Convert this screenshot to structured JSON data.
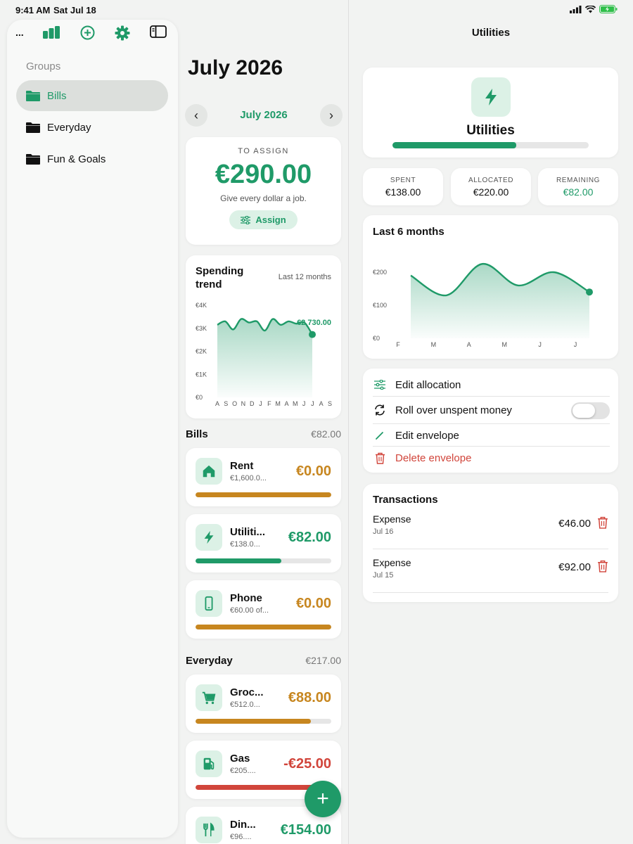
{
  "status_bar": {
    "time": "9:41 AM",
    "date": "Sat Jul 18"
  },
  "sidebar": {
    "more_label": "...",
    "groups_label": "Groups",
    "items": [
      {
        "label": "Bills",
        "active": true
      },
      {
        "label": "Everyday",
        "active": false
      },
      {
        "label": "Fun & Goals",
        "active": false
      }
    ]
  },
  "budget": {
    "month_title": "July 2026",
    "nav_month": "July 2026",
    "to_assign_label": "TO ASSIGN",
    "to_assign_amount": "€290.00",
    "to_assign_sub": "Give every dollar a job.",
    "assign_button": "Assign",
    "trend": {
      "title": "Spending trend",
      "range": "Last 12 months",
      "last_value_label": "€2,730.00"
    }
  },
  "groups": [
    {
      "name": "Bills",
      "amount": "€82.00",
      "envelopes": [
        {
          "name": "Rent",
          "sub": "€1,600.0...",
          "amount": "€0.00",
          "icon": "house-icon",
          "progress": 1.0,
          "status": "full"
        },
        {
          "name": "Utiliti...",
          "sub": "€138.0...",
          "amount": "€82.00",
          "icon": "bolt-icon",
          "progress": 0.63,
          "status": "ok"
        },
        {
          "name": "Phone",
          "sub": "€60.00 of...",
          "amount": "€0.00",
          "icon": "phone-icon",
          "progress": 1.0,
          "status": "full"
        }
      ]
    },
    {
      "name": "Everyday",
      "amount": "€217.00",
      "envelopes": [
        {
          "name": "Groc...",
          "sub": "€512.0...",
          "amount": "€88.00",
          "icon": "cart-icon",
          "progress": 0.85,
          "status": "warn"
        },
        {
          "name": "Gas",
          "sub": "€205....",
          "amount": "-€25.00",
          "icon": "fuel-icon",
          "progress": 1.0,
          "status": "over"
        },
        {
          "name": "Din...",
          "sub": "€96....",
          "amount": "€154.00",
          "icon": "fork-knife-icon",
          "progress": 0.4,
          "status": "ok"
        }
      ]
    }
  ],
  "colors": {
    "accent": "#1f9a68",
    "warn": "#c7861f",
    "over": "#d1453b",
    "track": "#e6e6e6"
  },
  "detail": {
    "nav_title": "Utilities",
    "name": "Utilities",
    "progress": 0.63,
    "stats": [
      {
        "label": "SPENT",
        "value": "€138.00"
      },
      {
        "label": "ALLOCATED",
        "value": "€220.00"
      },
      {
        "label": "REMAINING",
        "value": "€82.00"
      }
    ],
    "chart_title": "Last 6 months",
    "actions": {
      "edit_allocation": "Edit allocation",
      "rollover": "Roll over unspent money",
      "rollover_enabled": false,
      "edit_envelope": "Edit envelope",
      "delete_envelope": "Delete envelope"
    },
    "transactions_title": "Transactions",
    "transactions": [
      {
        "type": "Expense",
        "date": "Jul 16",
        "amount": "€46.00"
      },
      {
        "type": "Expense",
        "date": "Jul 15",
        "amount": "€92.00"
      }
    ]
  },
  "chart_data": [
    {
      "type": "area",
      "title": "Spending trend",
      "x": [
        "A",
        "S",
        "O",
        "N",
        "D",
        "J",
        "F",
        "M",
        "A",
        "M",
        "J",
        "J",
        "A",
        "S"
      ],
      "series": [
        {
          "values": [
            3150,
            3300,
            2950,
            3400,
            3250,
            3300,
            2900,
            3400,
            3150,
            3300,
            3200,
            3250,
            2730
          ]
        }
      ],
      "y_ticks": [
        "€0",
        "€1K",
        "€2K",
        "€3K",
        "€4K"
      ],
      "ylim": [
        0,
        4000
      ],
      "annotation": "€2,730.00"
    },
    {
      "type": "area",
      "title": "Last 6 months",
      "x": [
        "F",
        "M",
        "A",
        "M",
        "J",
        "J"
      ],
      "series": [
        {
          "values": [
            190,
            130,
            225,
            160,
            200,
            140
          ]
        }
      ],
      "y_ticks": [
        "€0",
        "€100",
        "€200"
      ],
      "ylim": [
        0,
        200
      ]
    }
  ]
}
